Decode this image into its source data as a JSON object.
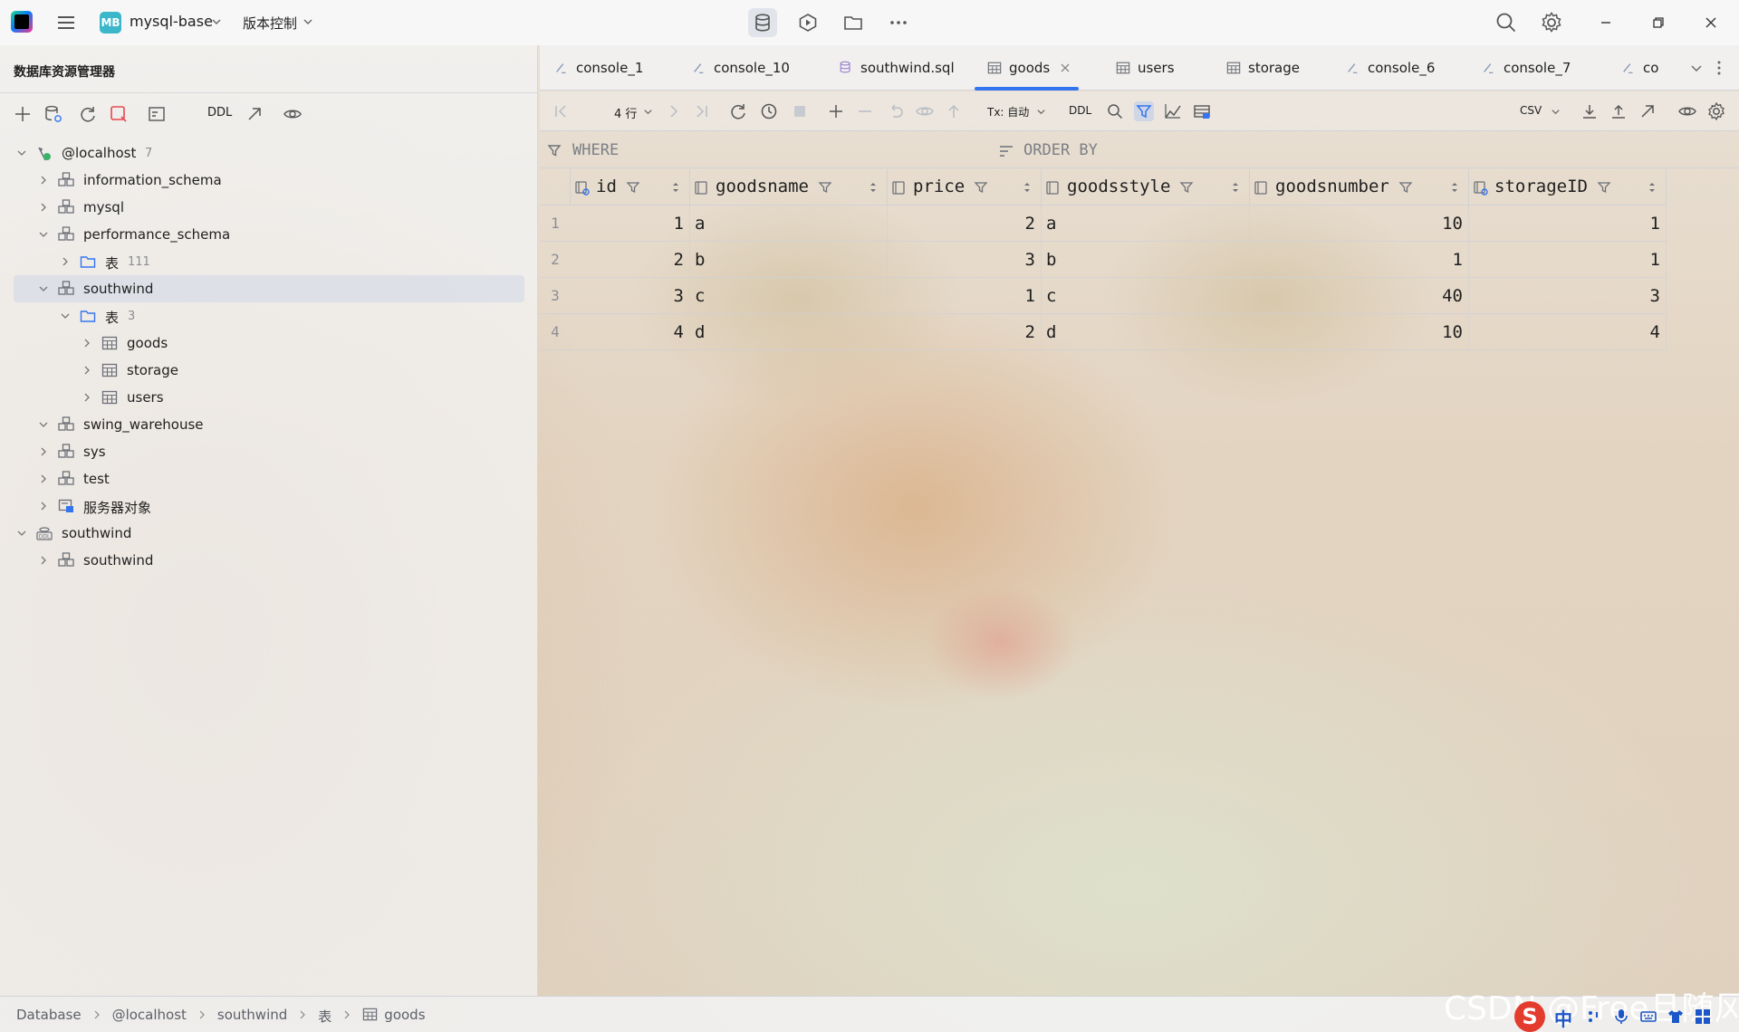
{
  "topbar": {
    "project_badge": "MB",
    "project_name": "mysql-base",
    "vcs_label": "版本控制"
  },
  "left_panel": {
    "title": "数据库资源管理器",
    "toolbar_ddl": "DDL",
    "tree": [
      {
        "label": "@localhost",
        "count": "7",
        "level": 0,
        "expanded": true,
        "icon": "datasource-icon"
      },
      {
        "label": "information_schema",
        "level": 1,
        "expanded": false,
        "icon": "schema-icon"
      },
      {
        "label": "mysql",
        "level": 1,
        "expanded": false,
        "icon": "schema-icon"
      },
      {
        "label": "performance_schema",
        "level": 1,
        "expanded": true,
        "icon": "schema-icon"
      },
      {
        "label": "表",
        "count": "111",
        "level": 2,
        "expanded": false,
        "icon": "folder-icon"
      },
      {
        "label": "southwind",
        "level": 1,
        "expanded": true,
        "icon": "schema-icon",
        "selected": true
      },
      {
        "label": "表",
        "count": "3",
        "level": 2,
        "expanded": true,
        "icon": "folder-icon"
      },
      {
        "label": "goods",
        "level": 3,
        "expanded": false,
        "icon": "table-icon"
      },
      {
        "label": "storage",
        "level": 3,
        "expanded": false,
        "icon": "table-icon"
      },
      {
        "label": "users",
        "level": 3,
        "expanded": false,
        "icon": "table-icon"
      },
      {
        "label": "swing_warehouse",
        "level": 1,
        "expanded": true,
        "icon": "schema-icon"
      },
      {
        "label": "sys",
        "level": 1,
        "expanded": false,
        "icon": "schema-icon"
      },
      {
        "label": "test",
        "level": 1,
        "expanded": false,
        "icon": "schema-icon"
      },
      {
        "label": "服务器对象",
        "level": 1,
        "expanded": false,
        "icon": "server-objects-icon"
      },
      {
        "label": "southwind",
        "level": 0,
        "expanded": true,
        "icon": "ddl-datasource-icon"
      },
      {
        "label": "southwind",
        "level": 1,
        "expanded": false,
        "icon": "schema-icon"
      }
    ]
  },
  "tabs": [
    {
      "label": "console_1",
      "icon": "console-icon"
    },
    {
      "label": "console_10",
      "icon": "console-icon"
    },
    {
      "label": "southwind.sql",
      "icon": "sql-file-icon"
    },
    {
      "label": "goods",
      "icon": "table-icon",
      "active": true
    },
    {
      "label": "users",
      "icon": "table-icon"
    },
    {
      "label": "storage",
      "icon": "table-icon"
    },
    {
      "label": "console_6",
      "icon": "console-icon"
    },
    {
      "label": "console_7",
      "icon": "console-icon"
    },
    {
      "label": "co",
      "icon": "console-icon"
    }
  ],
  "grid_toolbar": {
    "rows_label": "4 行",
    "tx_label": "Tx: 自动",
    "ddl_label": "DDL",
    "export_format": "CSV"
  },
  "filter": {
    "where_label": "WHERE",
    "orderby_label": "ORDER BY"
  },
  "table": {
    "columns": [
      {
        "name": "id",
        "key": true,
        "align": "right"
      },
      {
        "name": "goodsname",
        "key": false,
        "align": "left"
      },
      {
        "name": "price",
        "key": false,
        "align": "right"
      },
      {
        "name": "goodsstyle",
        "key": false,
        "align": "left"
      },
      {
        "name": "goodsnumber",
        "key": false,
        "align": "right"
      },
      {
        "name": "storageID",
        "key": true,
        "align": "right"
      }
    ],
    "rows": [
      {
        "num": "1",
        "cells": [
          "1",
          "a",
          "2",
          "a",
          "10",
          "1"
        ]
      },
      {
        "num": "2",
        "cells": [
          "2",
          "b",
          "3",
          "b",
          "1",
          "1"
        ]
      },
      {
        "num": "3",
        "cells": [
          "3",
          "c",
          "1",
          "c",
          "40",
          "3"
        ]
      },
      {
        "num": "4",
        "cells": [
          "4",
          "d",
          "2",
          "d",
          "10",
          "4"
        ]
      }
    ]
  },
  "statusbar": {
    "breadcrumbs": [
      "Database",
      "@localhost",
      "southwind",
      "表",
      "goods"
    ],
    "watermark": "CSDN @Free且随风",
    "ime_label": "中"
  }
}
